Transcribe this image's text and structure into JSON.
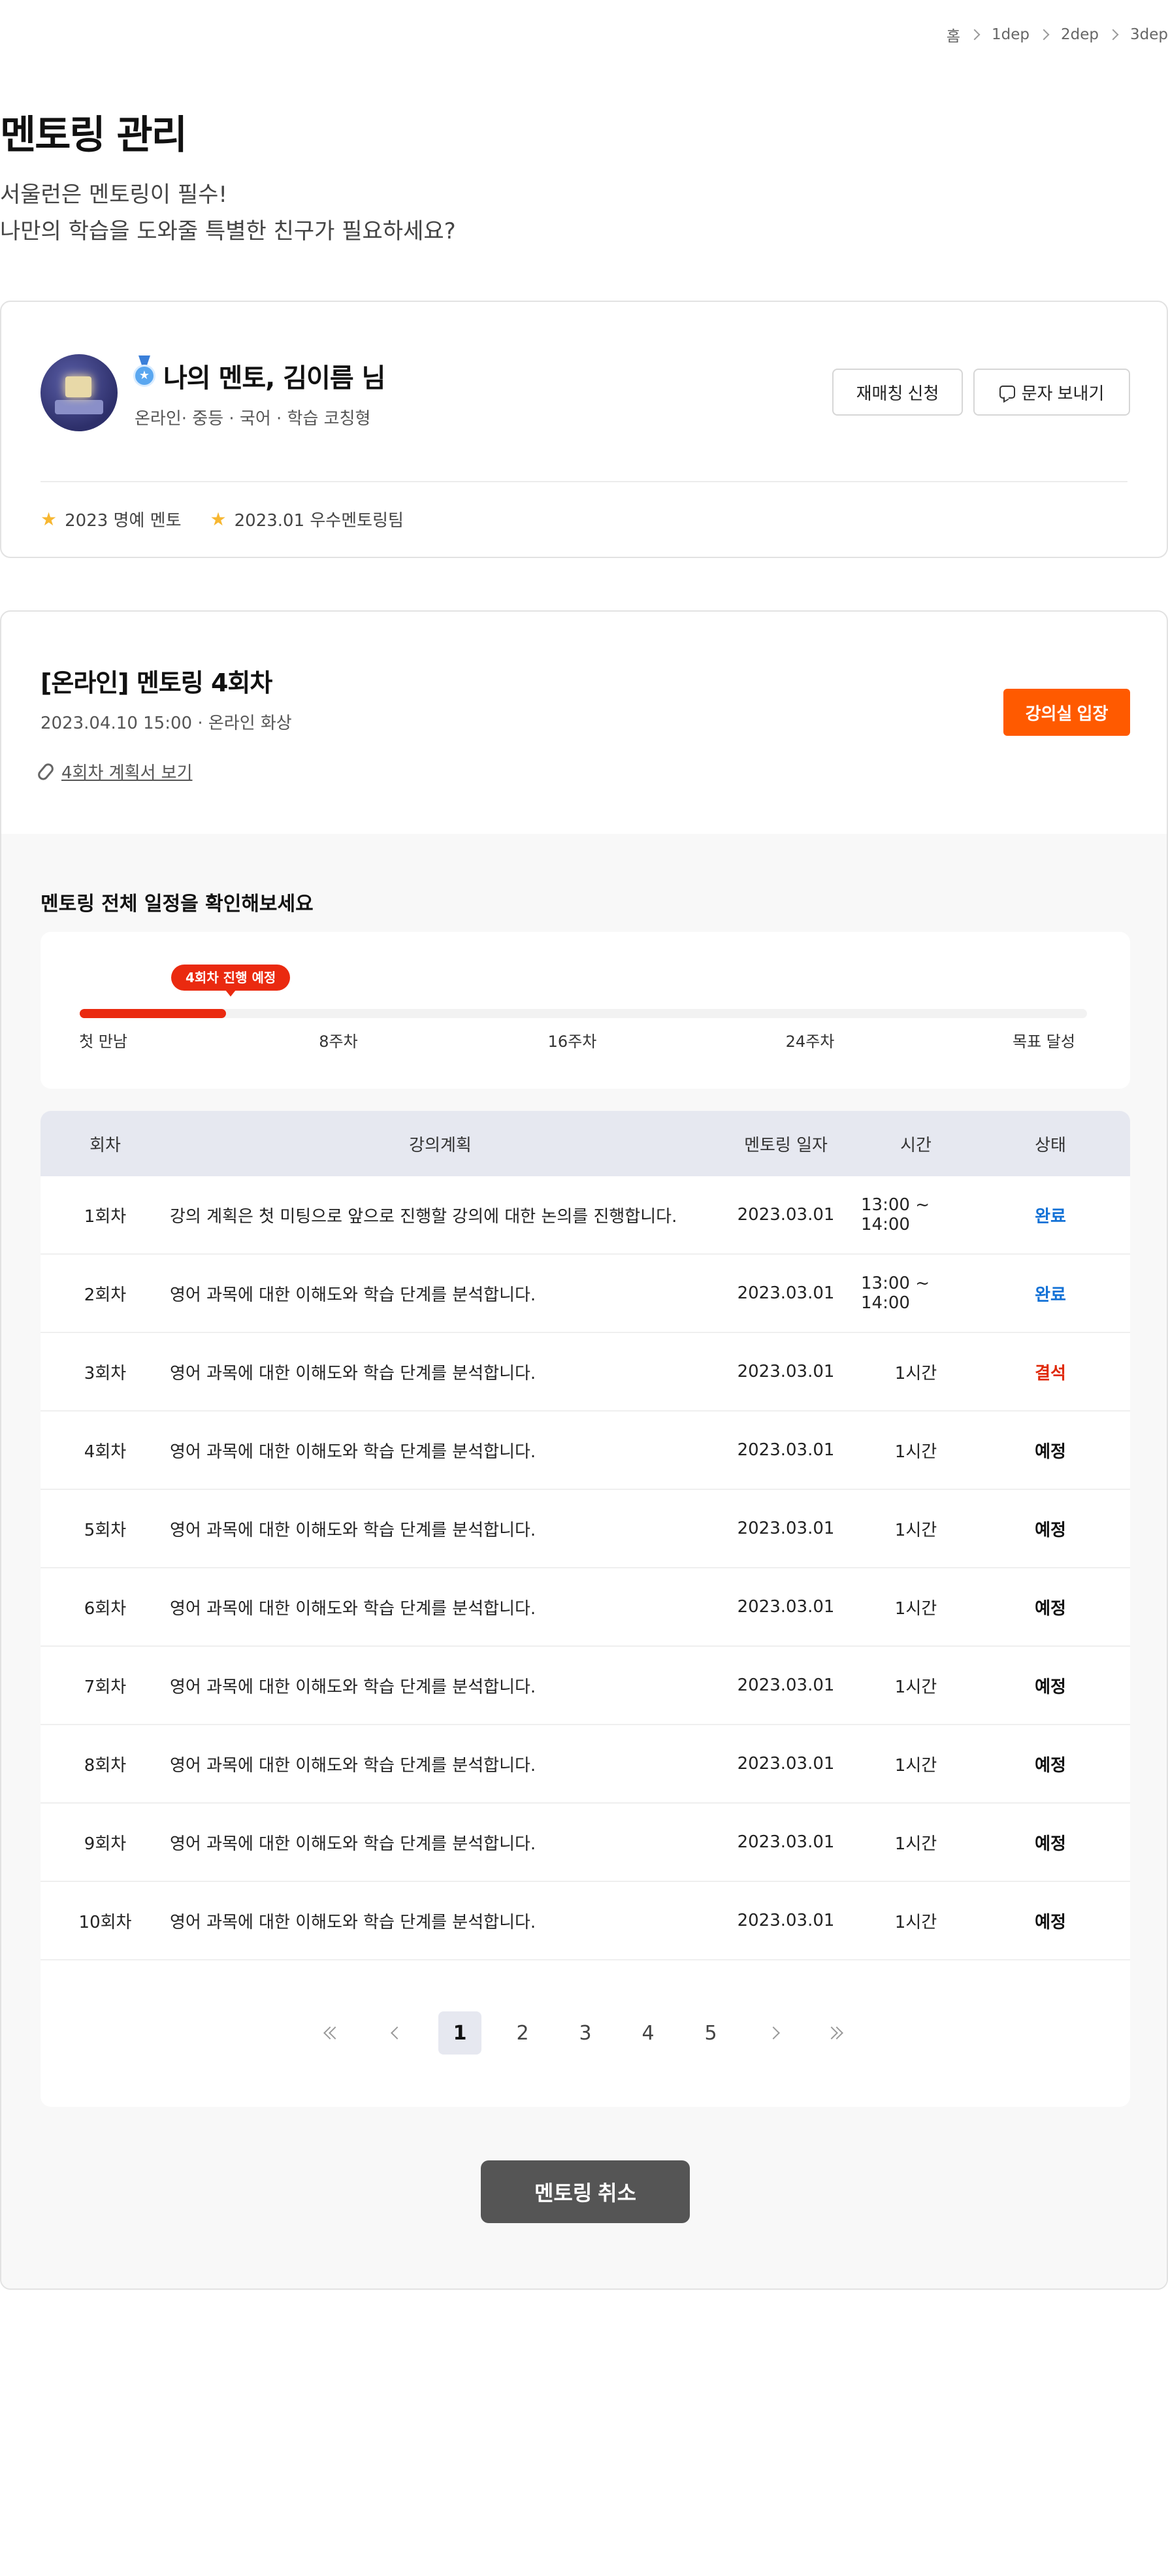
{
  "breadcrumb": [
    "홈",
    "1dep",
    "2dep",
    "3dep"
  ],
  "page_title": "멘토링 관리",
  "intro": [
    "서울런은 멘토링이 필수!",
    "나만의 학습을 도와줄 특별한 친구가 필요하세요?"
  ],
  "mentor": {
    "name": "나의 멘토, 김이름 님",
    "tags": "온라인· 중등 · 국어 · 학습 코칭형",
    "rematch_label": "재매칭 신청",
    "message_label": "문자 보내기",
    "badges": [
      "2023 명예 멘토",
      "2023.01 우수멘토링팀"
    ]
  },
  "session": {
    "title": "[온라인] 멘토링 4회차",
    "meta": "2023.04.10 15:00 · 온라인 화상",
    "attachment": "4회차 계획서 보기",
    "enter_label": "강의실 입장"
  },
  "schedule": {
    "heading": "멘토링 전체 일정을 확인해보세요",
    "progress_label": "4회차 진행 예정",
    "progress_fraction": 0.145,
    "milestones": [
      "첫 만남",
      "8주차",
      "16주차",
      "24주차",
      "목표 달성"
    ]
  },
  "table": {
    "headers": [
      "회차",
      "강의계획",
      "멘토링 일자",
      "시간",
      "상태"
    ],
    "rows": [
      {
        "round": "1회차",
        "plan": "강의 계획은 첫 미팅으로 앞으로 진행할 강의에 대한 논의를 진행합니다.",
        "date": "2023.03.01",
        "time": "13:00 ~ 14:00",
        "status": "완료"
      },
      {
        "round": "2회차",
        "plan": "영어 과목에 대한 이해도와 학습 단계를 분석합니다.",
        "date": "2023.03.01",
        "time": "13:00 ~ 14:00",
        "status": "완료"
      },
      {
        "round": "3회차",
        "plan": "영어 과목에 대한 이해도와 학습 단계를 분석합니다.",
        "date": "2023.03.01",
        "time": "1시간",
        "status": "결석"
      },
      {
        "round": "4회차",
        "plan": "영어 과목에 대한 이해도와 학습 단계를 분석합니다.",
        "date": "2023.03.01",
        "time": "1시간",
        "status": "예정"
      },
      {
        "round": "5회차",
        "plan": "영어 과목에 대한 이해도와 학습 단계를 분석합니다.",
        "date": "2023.03.01",
        "time": "1시간",
        "status": "예정"
      },
      {
        "round": "6회차",
        "plan": "영어 과목에 대한 이해도와 학습 단계를 분석합니다.",
        "date": "2023.03.01",
        "time": "1시간",
        "status": "예정"
      },
      {
        "round": "7회차",
        "plan": "영어 과목에 대한 이해도와 학습 단계를 분석합니다.",
        "date": "2023.03.01",
        "time": "1시간",
        "status": "예정"
      },
      {
        "round": "8회차",
        "plan": "영어 과목에 대한 이해도와 학습 단계를 분석합니다.",
        "date": "2023.03.01",
        "time": "1시간",
        "status": "예정"
      },
      {
        "round": "9회차",
        "plan": "영어 과목에 대한 이해도와 학습 단계를 분석합니다.",
        "date": "2023.03.01",
        "time": "1시간",
        "status": "예정"
      },
      {
        "round": "10회차",
        "plan": "영어 과목에 대한 이해도와 학습 단계를 분석합니다.",
        "date": "2023.03.01",
        "time": "1시간",
        "status": "예정"
      }
    ]
  },
  "pagination": {
    "pages": [
      "1",
      "2",
      "3",
      "4",
      "5"
    ],
    "current": "1"
  },
  "cancel_label": "멘토링 취소",
  "colors": {
    "accent": "#ff5a00",
    "progress": "#ea2a10",
    "done": "#1271d6",
    "absent": "#e0290a",
    "header_bg": "#e6e8f0"
  }
}
